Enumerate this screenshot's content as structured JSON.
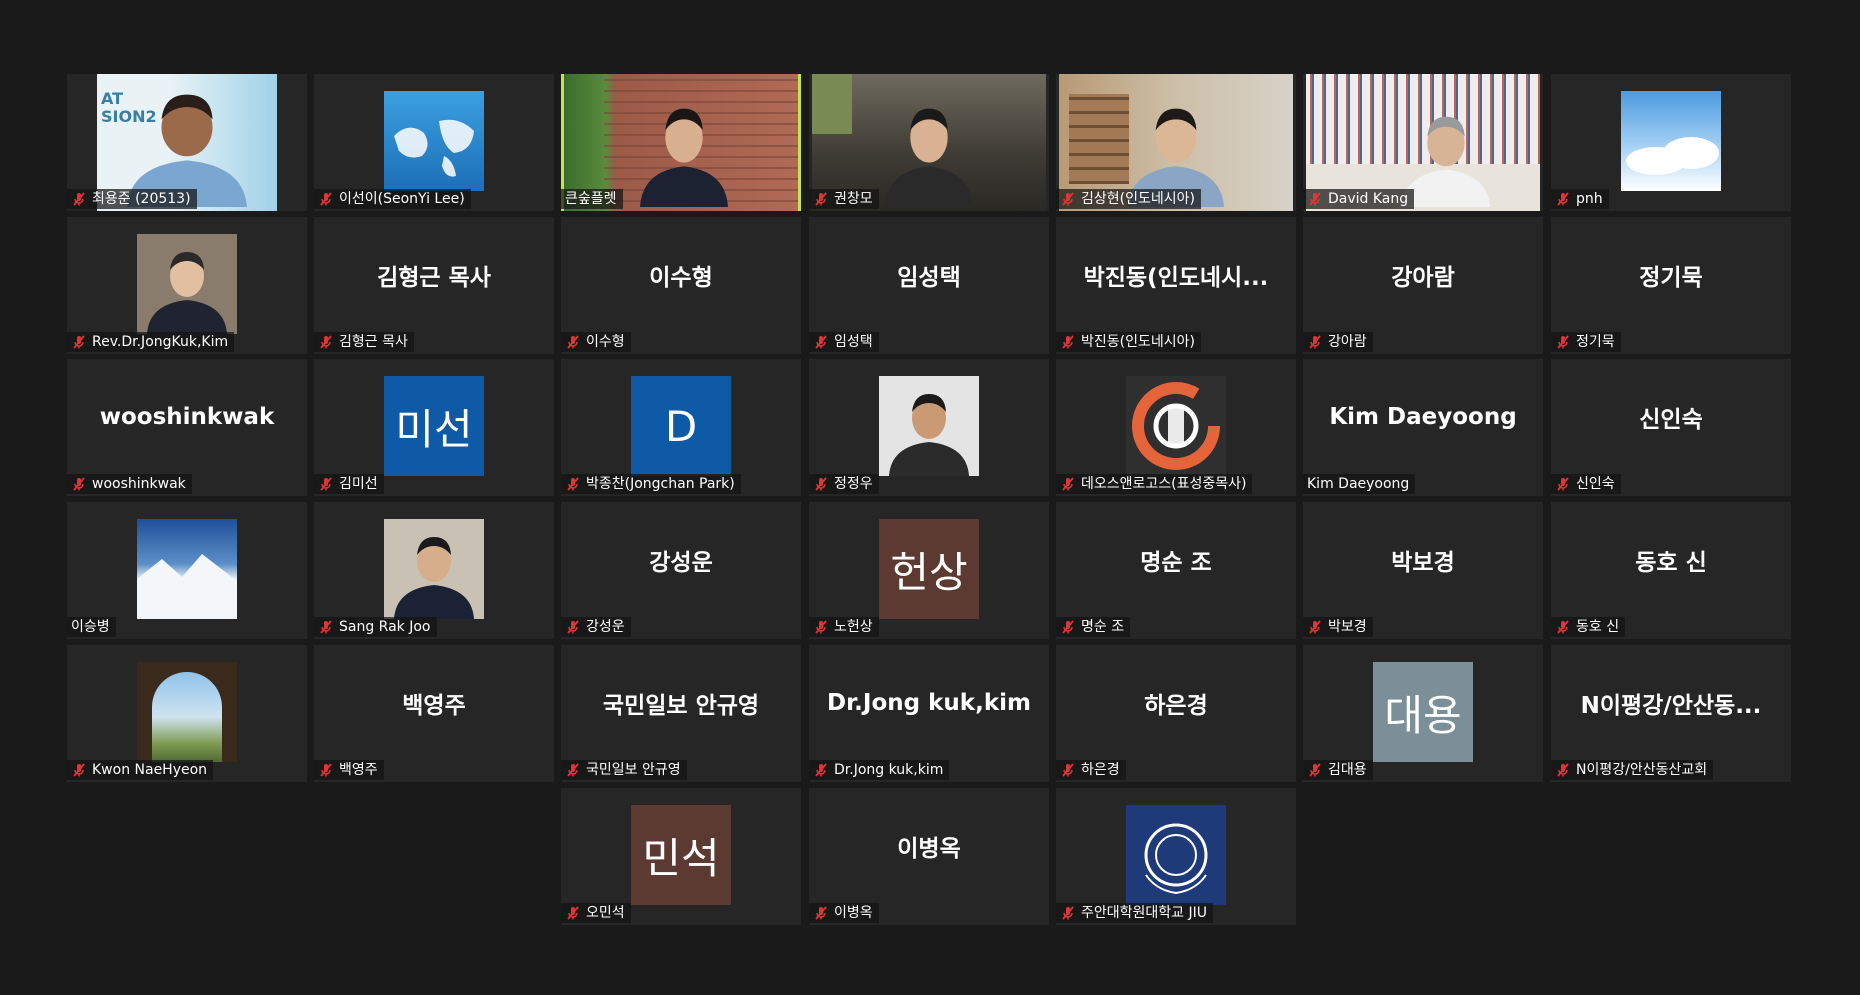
{
  "meeting": {
    "view": "gallery"
  },
  "colors": {
    "background": "#1a1a1a",
    "tile": "#262626",
    "active_speaker_border": "#c6e34a",
    "muted_icon": "#e03535"
  },
  "participants": [
    {
      "name": "최용준 (20513)",
      "muted": true,
      "display": "video"
    },
    {
      "name": "이선이(SeonYi Lee)",
      "muted": true,
      "display": "picture"
    },
    {
      "name": "큰숲플렛",
      "muted": false,
      "display": "video",
      "active_speaker": true
    },
    {
      "name": "권창모",
      "muted": true,
      "display": "video"
    },
    {
      "name": "김상현(인도네시아)",
      "muted": true,
      "display": "video"
    },
    {
      "name": "David Kang",
      "muted": true,
      "display": "video"
    },
    {
      "name": "pnh",
      "muted": true,
      "display": "picture"
    },
    {
      "name": "Rev.Dr.JongKuk,Kim",
      "muted": true,
      "display": "picture"
    },
    {
      "name": "김형근 목사",
      "center_text": "김형근 목사",
      "muted": true,
      "display": "text"
    },
    {
      "name": "이수형",
      "center_text": "이수형",
      "muted": true,
      "display": "text"
    },
    {
      "name": "임성택",
      "center_text": "임성택",
      "muted": true,
      "display": "text"
    },
    {
      "name": "박진동(인도네시아)",
      "center_text": "박진동(인도네시...",
      "muted": true,
      "display": "text"
    },
    {
      "name": "강아람",
      "center_text": "강아람",
      "muted": true,
      "display": "text"
    },
    {
      "name": "정기묵",
      "center_text": "정기묵",
      "muted": true,
      "display": "text"
    },
    {
      "name": "wooshinkwak",
      "center_text": "wooshinkwak",
      "muted": true,
      "display": "text"
    },
    {
      "name": "김미선",
      "avatar_text": "미선",
      "avatar_color": "#0e5aa7",
      "muted": true,
      "display": "avatar"
    },
    {
      "name": "박종찬(Jongchan Park)",
      "avatar_text": "D",
      "avatar_color": "#0e5aa7",
      "muted": true,
      "display": "avatar"
    },
    {
      "name": "정정우",
      "muted": true,
      "display": "picture"
    },
    {
      "name": "데오스앤로고스(표성중목사)",
      "muted": true,
      "display": "logo"
    },
    {
      "name": "Kim Daeyoong",
      "center_text": "Kim Daeyoong",
      "muted": false,
      "display": "text"
    },
    {
      "name": "신인숙",
      "center_text": "신인숙",
      "muted": true,
      "display": "text"
    },
    {
      "name": "이승병",
      "muted": false,
      "display": "picture"
    },
    {
      "name": "Sang Rak Joo",
      "muted": true,
      "display": "picture"
    },
    {
      "name": "강성운",
      "center_text": "강성운",
      "muted": true,
      "display": "text"
    },
    {
      "name": "노헌상",
      "avatar_text": "헌상",
      "avatar_color": "#5d3a31",
      "muted": true,
      "display": "avatar"
    },
    {
      "name": "명순 조",
      "center_text": "명순 조",
      "muted": true,
      "display": "text"
    },
    {
      "name": "박보경",
      "center_text": "박보경",
      "muted": true,
      "display": "text"
    },
    {
      "name": "동호 신",
      "center_text": "동호 신",
      "muted": true,
      "display": "text"
    },
    {
      "name": "Kwon NaeHyeon",
      "muted": true,
      "display": "picture"
    },
    {
      "name": "백영주",
      "center_text": "백영주",
      "muted": true,
      "display": "text"
    },
    {
      "name": "국민일보 안규영",
      "center_text": "국민일보 안규영",
      "muted": true,
      "display": "text"
    },
    {
      "name": "Dr.Jong kuk,kim",
      "center_text": "Dr.Jong kuk,kim",
      "muted": true,
      "display": "text"
    },
    {
      "name": "하은경",
      "center_text": "하은경",
      "muted": true,
      "display": "text"
    },
    {
      "name": "김대용",
      "avatar_text": "대용",
      "avatar_color": "#7a8f98",
      "muted": true,
      "display": "avatar"
    },
    {
      "name": "N이평강/안산동산교회",
      "center_text": "N이평강/안산동...",
      "muted": true,
      "display": "text"
    },
    {
      "name": "오민석",
      "avatar_text": "민석",
      "avatar_color": "#5d3a31",
      "muted": true,
      "display": "avatar"
    },
    {
      "name": "이병옥",
      "center_text": "이병옥",
      "muted": true,
      "display": "text"
    },
    {
      "name": "주안대학원대학교 JIU",
      "muted": true,
      "display": "logo"
    }
  ]
}
